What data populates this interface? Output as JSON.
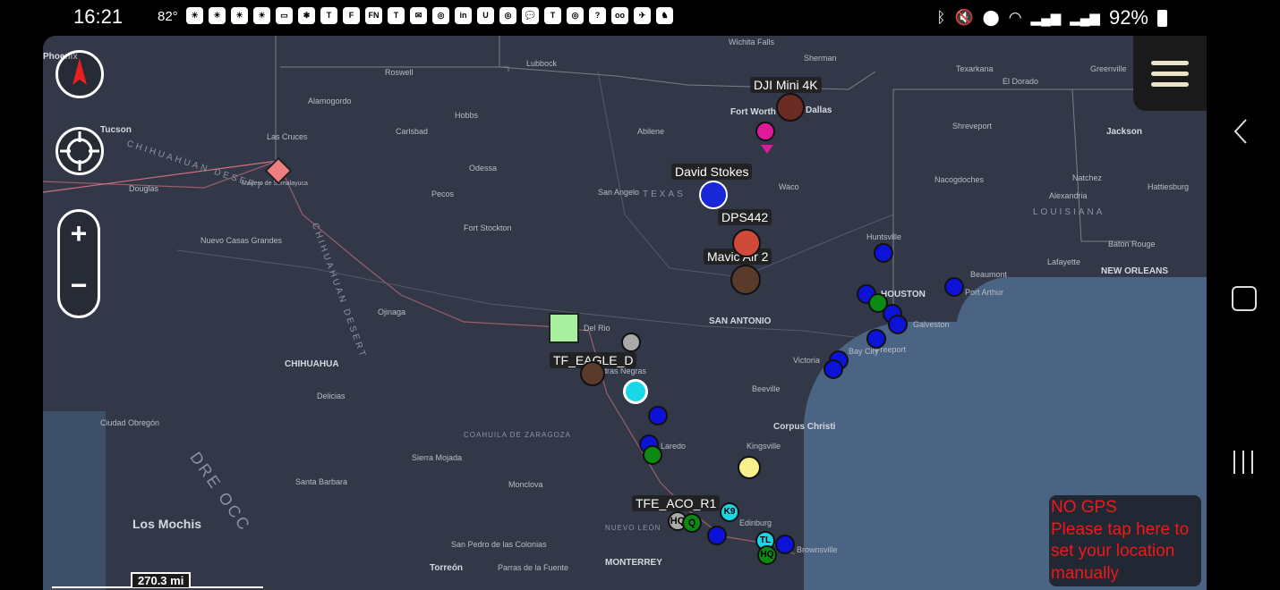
{
  "status_bar": {
    "time": "16:21",
    "temperature": "82°",
    "app_icons": [
      "weather-icon",
      "fox-news-icon",
      "tesla-icon",
      "flipboard-icon",
      "teams-icon",
      "mail-icon",
      "linkedin-icon",
      "uber-icon",
      "chat-icon",
      "voicemail-icon",
      "help-icon"
    ],
    "battery": "92%"
  },
  "map": {
    "map_labels": [
      "Lubbock",
      "Wichita Falls",
      "Sherman",
      "Texarkana",
      "Greenville",
      "El Dorado",
      "Roswell",
      "Alamogordo",
      "Las Cruces",
      "Hobbs",
      "Carlsbad",
      "Fort Worth",
      "Dallas",
      "Shreveport",
      "Jackson",
      "Abilene",
      "Odessa",
      "Pecos",
      "San Angelo",
      "TEXAS",
      "Waco",
      "Nacogdoches",
      "Natchez",
      "Hattiesburg",
      "Alexandria",
      "Fort Stockton",
      "LOUISIANA",
      "Lafayette",
      "Baton Rouge",
      "NEW ORLEANS",
      "Huntsville",
      "HOUSTON",
      "Beaumont",
      "Port Arthur",
      "Galveston",
      "SAN ANTONIO",
      "Del Rio",
      "Piedras Negras",
      "CHIHUAHUA",
      "Ojinaga",
      "Delicias",
      "Nuevo Casas Grandes",
      "Ciudad Obregón",
      "Los Mochis",
      "Santa Barbara",
      "Sierra Mojada",
      "COAHUILA DE ZARAGOZA",
      "Monclova",
      "Laredo",
      "Victoria",
      "Beeville",
      "Corpus Christi",
      "Kingsville",
      "Edinburg",
      "Brownsville",
      "NUEVO LEÓN",
      "MONTERREY",
      "Torreón",
      "San Pedro de las Colonias",
      "Parras de la Fuente",
      "Douglas",
      "Tucson",
      "Phoenix",
      "Madero de Semalayuca",
      "Freeport",
      "Bay City"
    ],
    "region_labels": [
      "CHIHUAHUAN DESERT",
      "CHIHUAHUAN DESERT",
      "DRE OCC"
    ],
    "track_labels": [
      "DJI Mini 4K",
      "David Stokes",
      "DPS442",
      "Mavic Air 2",
      "TF_EAGLE_D",
      "TFE_ACO_R1"
    ],
    "unit_badges": [
      "HQ",
      "Q",
      "K9",
      "TL",
      "HQ",
      "K9"
    ],
    "scale": "270.3 mi"
  },
  "controls": {
    "compass_label": "compass",
    "zoom_in": "+",
    "zoom_out": "−",
    "menu": "menu"
  },
  "gps_notice": {
    "line1": "NO GPS",
    "line2": "Please tap here to",
    "line3": "set your location",
    "line4": "manually"
  },
  "colors": {
    "map_land": "#323848",
    "map_water": "#4b6483",
    "friendly_blue": "#0c12d8",
    "friendly_green": "#0a8a12",
    "alert_text": "#f01818",
    "drone_icon": "#b03a2a"
  }
}
